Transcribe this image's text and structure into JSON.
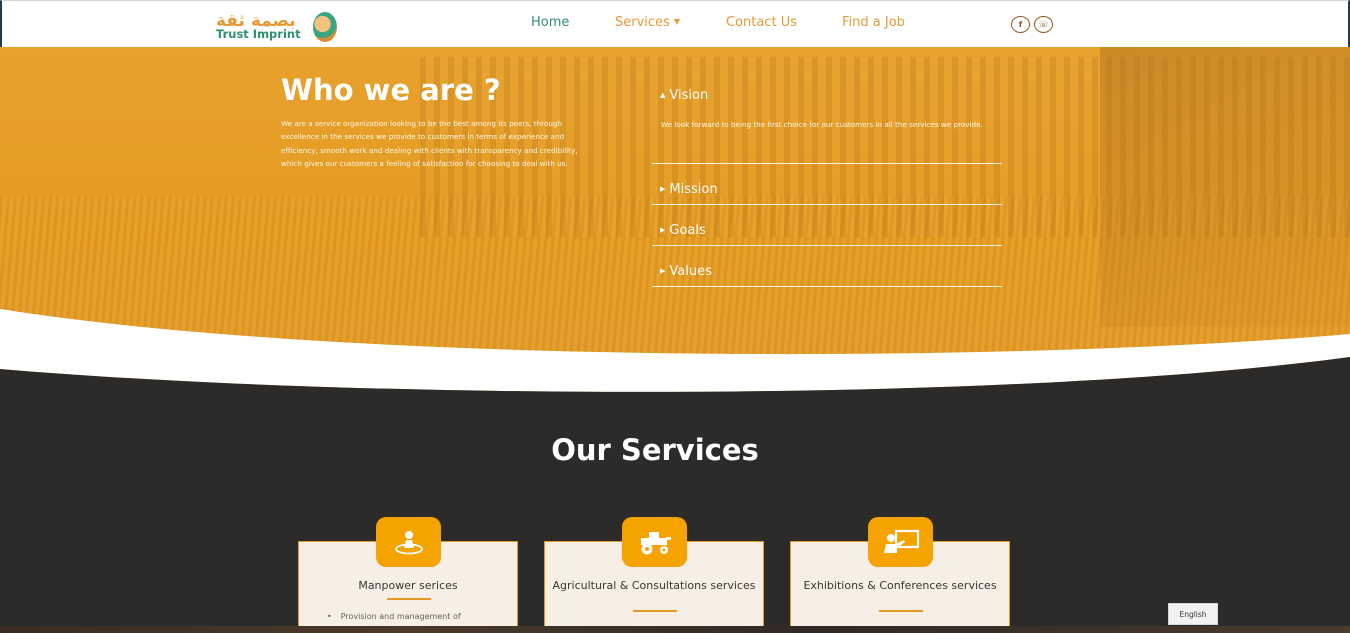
{
  "header": {
    "logo_arabic": "بصمة ثقة",
    "logo_english": "Trust Imprint",
    "nav": {
      "home": "Home",
      "services": "Services",
      "contact": "Contact Us",
      "job": "Find a Job"
    },
    "social_icons": [
      "facebook-icon",
      "whatsapp-icon"
    ],
    "colors": {
      "brand_green": "#2f8f6e",
      "brand_orange": "#e49a36"
    }
  },
  "about": {
    "title": "Who we are ?",
    "text": "We are a service organization looking to be the best among its peers, through excellence in the services we provide to customers in terms of experience and efficiency, smooth work and dealing with clients with transparency and credibility, which gives our customers a feeling of satisfaction for choosing to deal with us.",
    "accordion": [
      {
        "label": "Vision",
        "body": "We look forward to being the first choice for our customers in all the services we provide."
      },
      {
        "label": "Mission"
      },
      {
        "label": "Goals"
      },
      {
        "label": "Values"
      }
    ]
  },
  "services": {
    "title": "Our Services",
    "cards": [
      {
        "title": "Manpower serices",
        "icon": "person-pin-icon",
        "items": [
          "Provision and management of"
        ]
      },
      {
        "title": "Agricultural & Consultations services",
        "icon": "tractor-icon"
      },
      {
        "title": "Exhibitions & Conferences services",
        "icon": "presentation-icon"
      }
    ]
  },
  "language_button": "English"
}
